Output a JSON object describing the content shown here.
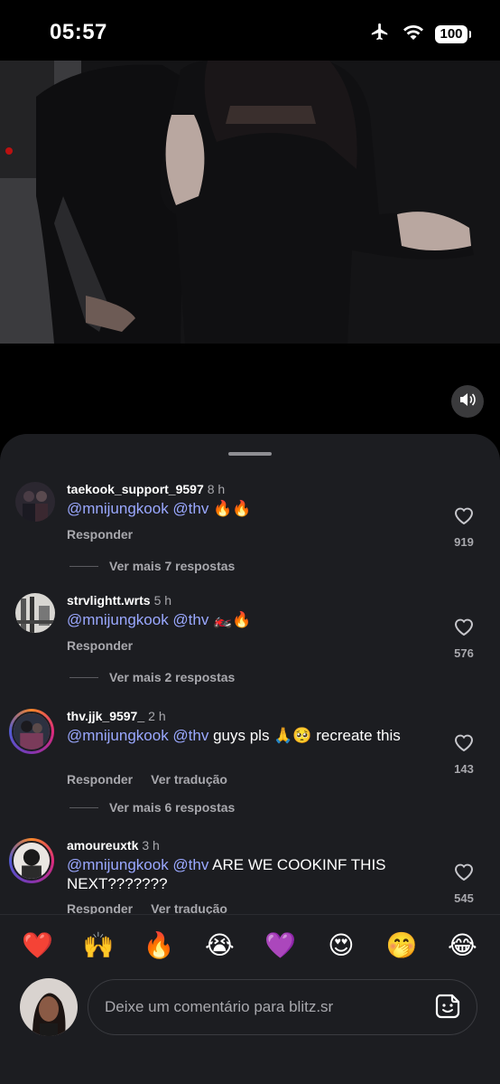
{
  "status_bar": {
    "time": "05:57",
    "battery": "100",
    "icons": [
      "airplane-icon",
      "wifi-icon",
      "battery-icon"
    ]
  },
  "video": {
    "mute_icon": "speaker-icon"
  },
  "comments": [
    {
      "username": "taekook_support_9597",
      "time": "8 h",
      "mentions": "@mnijungkook @thv",
      "text": " 🔥🔥",
      "reply_label": "Responder",
      "translate_label": "",
      "likes": "919",
      "more_replies": "Ver mais 7 respostas"
    },
    {
      "username": "strvlightt.wrts",
      "time": "5 h",
      "mentions": "@mnijungkook @thv",
      "text": " 🏍️🔥",
      "reply_label": "Responder",
      "translate_label": "",
      "likes": "576",
      "more_replies": "Ver mais 2 respostas"
    },
    {
      "username": "thv.jjk_9597_",
      "time": "2 h",
      "mentions": "@mnijungkook @thv",
      "text": " guys pls 🙏🥺 recreate this",
      "reply_label": "Responder",
      "translate_label": "Ver tradução",
      "likes": "143",
      "more_replies": "Ver mais 6 respostas"
    },
    {
      "username": "amoureuxtk",
      "time": "3 h",
      "mentions": "@mnijungkook @thv",
      "text": " ARE WE COOKINF THIS NEXT???????",
      "reply_label": "Responder",
      "translate_label": "Ver tradução",
      "likes": "545",
      "more_replies": ""
    }
  ],
  "emoji_bar": [
    "❤️",
    "🙌",
    "🔥",
    "😭",
    "💜",
    "😍",
    "🤭",
    "😂"
  ],
  "compose": {
    "placeholder": "Deixe um comentário para blitz.sr",
    "sticker_icon": "sticker-icon"
  },
  "colors": {
    "sheet_bg": "#1c1d21",
    "mention": "#9aa8ff",
    "secondary_text": "#a8a8ad"
  }
}
